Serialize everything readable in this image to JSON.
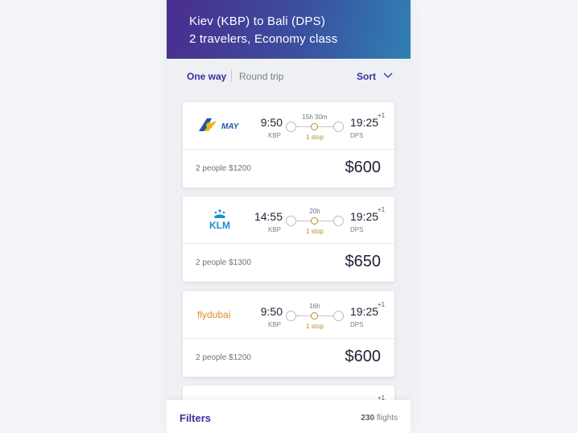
{
  "header": {
    "route": "Kiev (KBP) to Bali (DPS)",
    "details": "2 travelers, Economy class"
  },
  "controls": {
    "tab_one_way": "One way",
    "tab_round_trip": "Round trip",
    "sort": "Sort"
  },
  "flights": [
    {
      "airline_logo": "MAY",
      "dep_time": "9:50",
      "dep_code": "KBP",
      "duration": "15h 30m",
      "stops": "1 stop",
      "arr_time": "19:25",
      "arr_offset": "+1",
      "arr_code": "DPS",
      "people": "2 people $1200",
      "price": "$600"
    },
    {
      "airline_logo": "KLM",
      "dep_time": "14:55",
      "dep_code": "KBP",
      "duration": "20h",
      "stops": "1 stop",
      "arr_time": "19:25",
      "arr_offset": "+1",
      "arr_code": "DPS",
      "people": "2 people $1300",
      "price": "$650"
    },
    {
      "airline_logo": "flydubai",
      "dep_time": "9:50",
      "dep_code": "KBP",
      "duration": "16h",
      "stops": "1 stop",
      "arr_time": "19:25",
      "arr_offset": "+1",
      "arr_code": "DPS",
      "people": "2 people $1200",
      "price": "$600"
    },
    {
      "arr_offset": "+1"
    }
  ],
  "footer": {
    "filters": "Filters",
    "flight_count": "230",
    "flight_count_suffix": "flights"
  },
  "colors": {
    "accent": "#3b2ea0",
    "stop": "#b98a2c",
    "header_gradient_start": "#4a2d8e",
    "header_gradient_end": "#2f80b3"
  }
}
